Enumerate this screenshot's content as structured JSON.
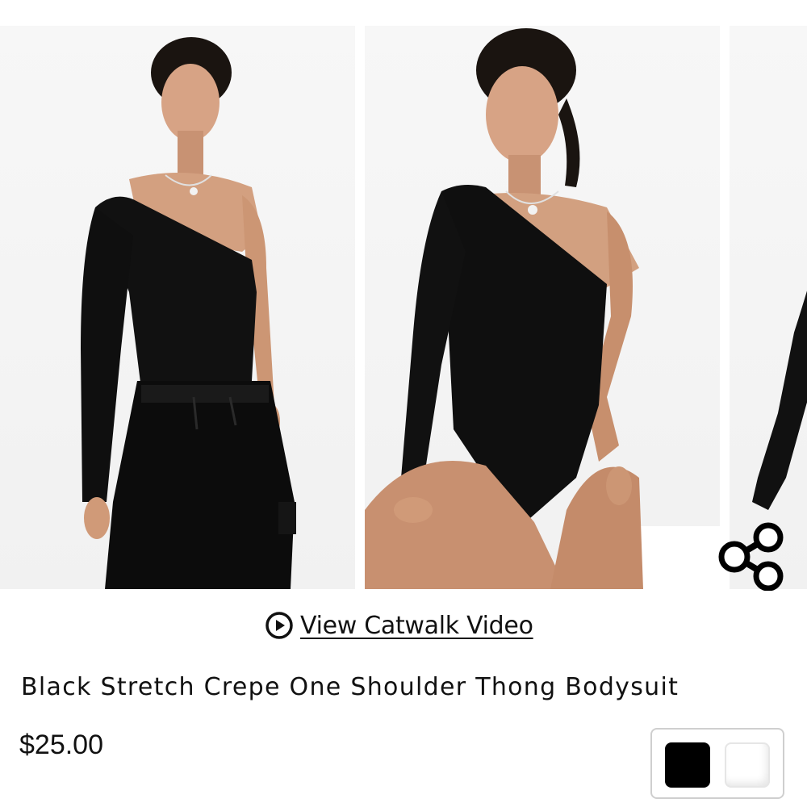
{
  "product": {
    "title": "Black Stretch Crepe One Shoulder Thong Bodysuit",
    "price": "$25.00"
  },
  "video_link": {
    "label": "View Catwalk Video",
    "icon": "play-circle-icon"
  },
  "share": {
    "icon": "share-icon"
  },
  "gallery": {
    "images": [
      {
        "alt": "Model wearing black one shoulder bodysuit with black cargo trousers"
      },
      {
        "alt": "Model seated wearing black one shoulder thong bodysuit"
      },
      {
        "alt": "Partial view of next product image"
      }
    ]
  },
  "swatches": [
    {
      "color": "#000000",
      "selected": true
    },
    {
      "color": "#ffffff",
      "selected": false
    }
  ],
  "colors": {
    "text": "#111111",
    "border": "#cfcfcf"
  }
}
